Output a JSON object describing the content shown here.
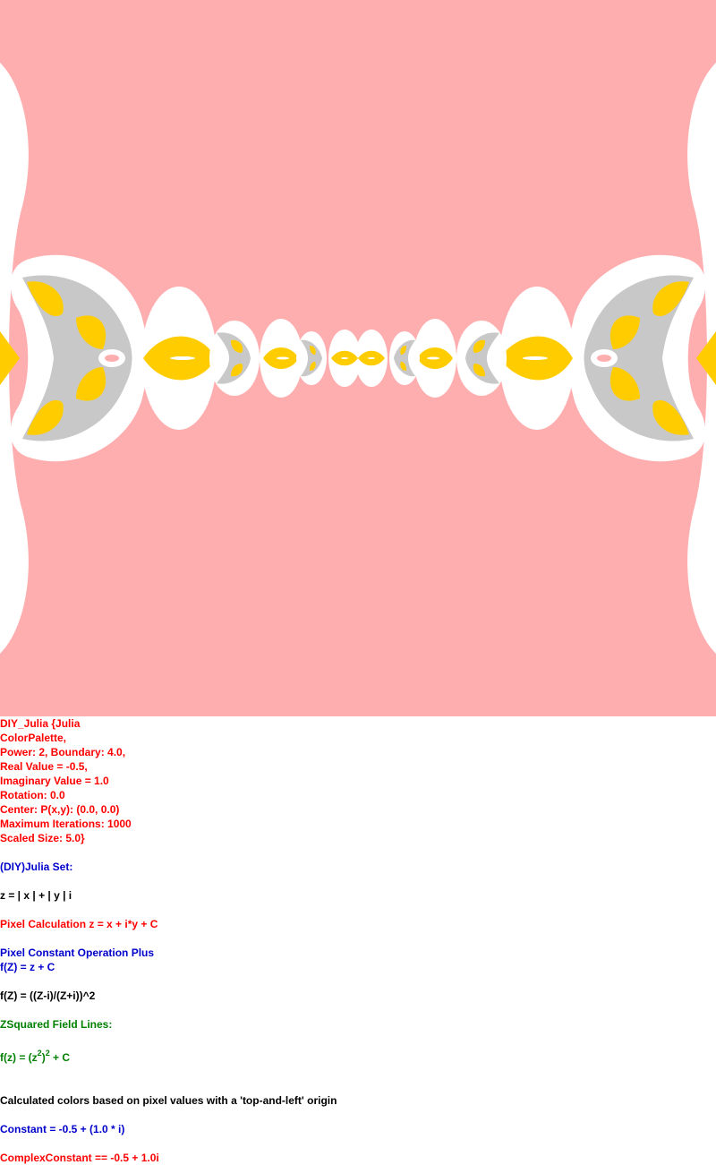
{
  "image": {
    "colors": {
      "background": "#ffaeb0",
      "exterior": "#ffffff",
      "fill": "#ffcc00",
      "band": "#c8c8c8"
    }
  },
  "params": {
    "l1": "DIY_Julia {Julia",
    "l2": "ColorPalette,",
    "l3": "Power: 2, Boundary: 4.0,",
    "l4": "Real Value = -0.5,",
    "l5": "Imaginary Value = 1.0",
    "l6": "Rotation: 0.0",
    "l7": "Center: P(x,y): (0.0, 0.0)",
    "l8": "Maximum Iterations: 1000",
    "l9": "Scaled Size: 5.0}"
  },
  "desc": {
    "julia_set": "(DIY)Julia Set:",
    "z_eq": "z = | x | + | y | i",
    "pixel_calc": "Pixel Calculation z = x + i*y + C",
    "pixel_const": "Pixel Constant Operation Plus",
    "fz1": "f(Z) = z + C",
    "fz2": "f(Z) = ((Z-i)/(Z+i))^2",
    "zsq": "ZSquared Field Lines:",
    "fz3_a": "f(z) = (z",
    "fz3_sup1": "2",
    "fz3_b": ")",
    "fz3_sup2": "2",
    "fz3_c": " + C",
    "calc_colors": "Calculated colors based on pixel values with a 'top-and-left' origin",
    "constant": "Constant = -0.5 + (1.0 * i)",
    "complex_constant": "ComplexConstant == -0.5 + 1.0i"
  }
}
